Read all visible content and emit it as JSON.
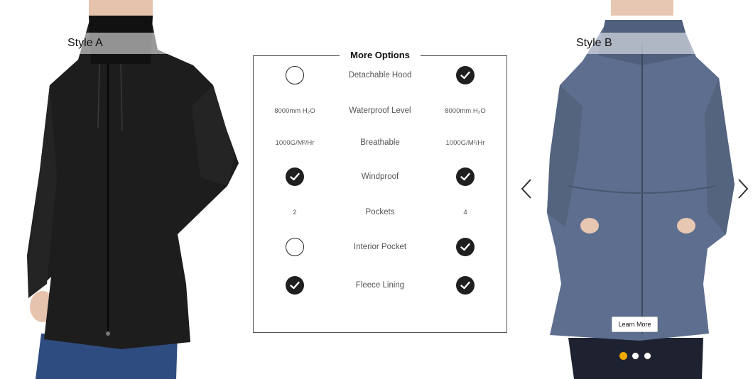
{
  "style_a": {
    "label": "Style A"
  },
  "style_b": {
    "label": "Style B"
  },
  "comparison": {
    "title": "More Options",
    "rows": [
      {
        "feature": "Detachable Hood",
        "a": "",
        "b": ""
      },
      {
        "feature": "Waterproof Level",
        "a": "8000mm H₂O",
        "b": "8000mm H₂O"
      },
      {
        "feature": "Breathable",
        "a": "1000G/M²/Hr",
        "b": "1000G/M²/Hr"
      },
      {
        "feature": "Windproof",
        "a": "",
        "b": ""
      },
      {
        "feature": "Pockets",
        "a": "2",
        "b": "4"
      },
      {
        "feature": "Interior Pocket",
        "a": "",
        "b": ""
      },
      {
        "feature": "Fleece Lining",
        "a": "",
        "b": ""
      }
    ]
  },
  "carousel": {
    "learn_more_label": "Learn More",
    "dot_count": 3,
    "active_dot": 1
  },
  "icons": {
    "check": "check-circle-icon",
    "empty": "empty-circle-icon",
    "prev": "chevron-left-icon",
    "next": "chevron-right-icon"
  },
  "colors": {
    "active_dot": "#f0a800",
    "check_fill": "#1f1f1f",
    "coat_b": "#5d6e8e"
  }
}
